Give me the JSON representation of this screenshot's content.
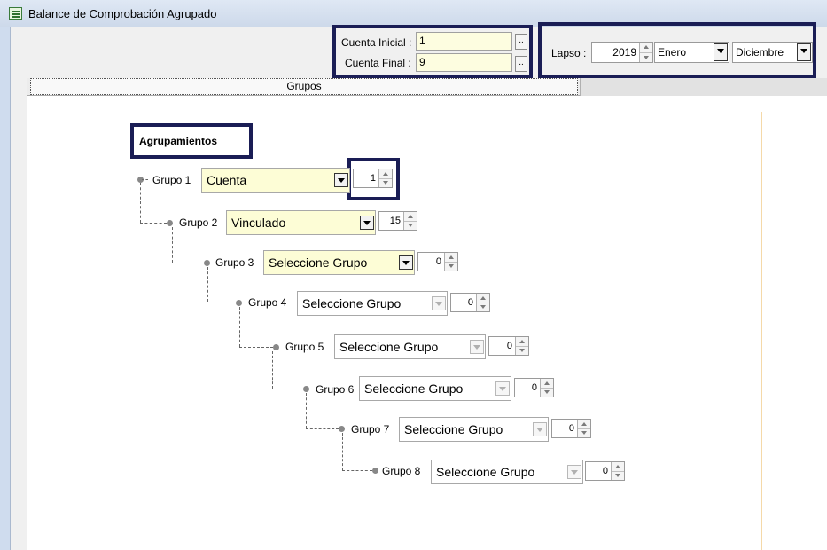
{
  "window": {
    "title": "Balance de Comprobación Agrupado"
  },
  "cuentas": {
    "inicial_label": "Cuenta Inicial :",
    "inicial_value": "1",
    "final_label": "Cuenta Final :",
    "final_value": "9",
    "browse_label": ".."
  },
  "lapso": {
    "label": "Lapso :",
    "year": "2019",
    "mes_desde": "Enero",
    "mes_hasta": "Diciembre"
  },
  "tabs": [
    {
      "label": "Grupos"
    },
    {
      "label": ""
    }
  ],
  "agrupamientos": {
    "title": "Agrupamientos",
    "grupos": [
      {
        "label": "Grupo 1",
        "value": "Cuenta",
        "level": "1",
        "enabled": true
      },
      {
        "label": "Grupo 2",
        "value": "Vinculado",
        "level": "15",
        "enabled": true
      },
      {
        "label": "Grupo 3",
        "value": "Seleccione Grupo",
        "level": "0",
        "enabled": true
      },
      {
        "label": "Grupo 4",
        "value": "Seleccione Grupo",
        "level": "0",
        "enabled": false
      },
      {
        "label": "Grupo 5",
        "value": "Seleccione Grupo",
        "level": "0",
        "enabled": false
      },
      {
        "label": "Grupo 6",
        "value": "Seleccione Grupo",
        "level": "0",
        "enabled": false
      },
      {
        "label": "Grupo 7",
        "value": "Seleccione Grupo",
        "level": "0",
        "enabled": false
      },
      {
        "label": "Grupo 8",
        "value": "Seleccione Grupo",
        "level": "0",
        "enabled": false
      }
    ]
  },
  "colors": {
    "highlight_border": "#1a1d55",
    "field_background": "#fdfdd6"
  }
}
